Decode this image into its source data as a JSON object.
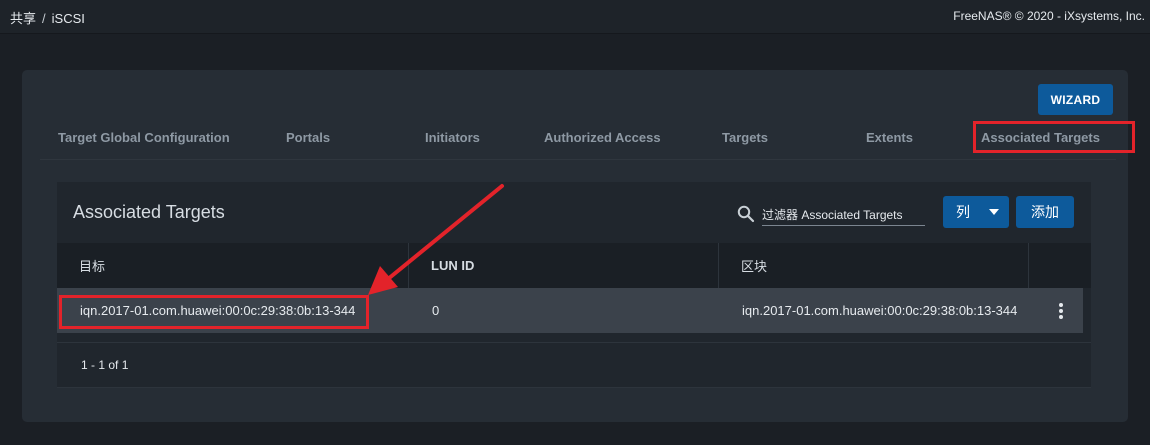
{
  "topbar": {
    "breadcrumb": [
      "共享",
      "iSCSI"
    ],
    "separator": "/",
    "copyright": "FreeNAS® © 2020 - iXsystems, Inc."
  },
  "wizard_label": "WIZARD",
  "tabs": [
    {
      "label": "Target Global Configuration"
    },
    {
      "label": "Portals"
    },
    {
      "label": "Initiators"
    },
    {
      "label": "Authorized Access"
    },
    {
      "label": "Targets"
    },
    {
      "label": "Extents"
    },
    {
      "label": "Associated Targets",
      "active": true
    }
  ],
  "card": {
    "title": "Associated Targets",
    "filter_placeholder": "过滤器 Associated Targets",
    "columns_button": "列",
    "add_button": "添加"
  },
  "table": {
    "headers": [
      "目标",
      "LUN ID",
      "区块"
    ],
    "rows": [
      {
        "target": "iqn.2017-01.com.huawei:00:0c:29:38:0b:13-344",
        "lun_id": "0",
        "extent": "iqn.2017-01.com.huawei:00:0c:29:38:0b:13-344"
      }
    ]
  },
  "pager": "1 - 1 of 1",
  "colors": {
    "accent": "#0d5a9b",
    "annotation": "#e3232a"
  }
}
